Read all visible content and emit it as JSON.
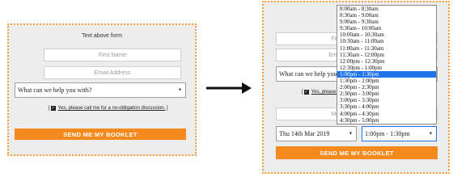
{
  "left_form": {
    "text_above": "Text above form",
    "first_name_placeholder": "First Name",
    "email_placeholder": "Email Address",
    "help_select_value": "What can we help you with?",
    "checkbox_label": "Yes, please call me for a no-obligation discussion.",
    "send_button_label": "SEND ME MY BOOKLET"
  },
  "right_form": {
    "text_above": "Text abov",
    "first_name_placeholder": "First N",
    "email_placeholder": "Email A",
    "help_select_value": "What can we help you with?",
    "checkbox_label": "Yes, please call me for a",
    "mobile_placeholder": "Mobile",
    "date_select_value": "Thu 14th Mar 2019",
    "time_select_value": "1:00pm - 1:30pm",
    "send_button_label": "SEND ME MY BOOKLET",
    "time_options": [
      "8:00am - 8:30am",
      "8:30am - 9:00am",
      "9:00am - 9:30am",
      "9:30am - 10:00am",
      "10:00am - 10:30am",
      "10:30am - 11:00am",
      "11:00am - 11:30am",
      "11:30am - 12:00pm",
      "12:00pm - 12:30pm",
      "12:30pm - 1:00pm",
      "1:00pm - 1:30pm",
      "1:30pm - 2:00pm",
      "2:00pm - 2:30pm",
      "2:30pm - 3:00pm",
      "3:00pm - 3:30pm",
      "3:30pm - 4:00pm",
      "4:00pm - 4:30pm",
      "4:30pm - 5:00pm"
    ],
    "selected_time_index": 10
  },
  "icons": {
    "caret": "caret-down-icon",
    "checkbox": "checkbox-checked-icon",
    "arrow": "right-arrow-icon"
  },
  "colors": {
    "accent": "#f48a1e",
    "panel_border": "#f0a13a",
    "panel_bg": "#ededed",
    "selected_option": "#1e73e8"
  }
}
